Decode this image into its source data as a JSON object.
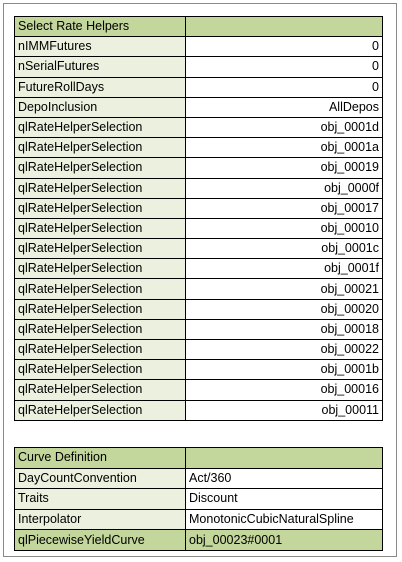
{
  "rate_helpers": {
    "header": "Select Rate Helpers",
    "params": [
      {
        "label": "nIMMFutures",
        "value": "0"
      },
      {
        "label": "nSerialFutures",
        "value": "0"
      },
      {
        "label": "FutureRollDays",
        "value": "0"
      },
      {
        "label": "DepoInclusion",
        "value": "AllDepos"
      }
    ],
    "selections": [
      {
        "label": "qlRateHelperSelection",
        "value": "obj_0001d"
      },
      {
        "label": "qlRateHelperSelection",
        "value": "obj_0001a"
      },
      {
        "label": "qlRateHelperSelection",
        "value": "obj_00019"
      },
      {
        "label": "qlRateHelperSelection",
        "value": "obj_0000f"
      },
      {
        "label": "qlRateHelperSelection",
        "value": "obj_00017"
      },
      {
        "label": "qlRateHelperSelection",
        "value": "obj_00010"
      },
      {
        "label": "qlRateHelperSelection",
        "value": "obj_0001c"
      },
      {
        "label": "qlRateHelperSelection",
        "value": "obj_0001f"
      },
      {
        "label": "qlRateHelperSelection",
        "value": "obj_00021"
      },
      {
        "label": "qlRateHelperSelection",
        "value": "obj_00020"
      },
      {
        "label": "qlRateHelperSelection",
        "value": "obj_00018"
      },
      {
        "label": "qlRateHelperSelection",
        "value": "obj_00022"
      },
      {
        "label": "qlRateHelperSelection",
        "value": "obj_0001b"
      },
      {
        "label": "qlRateHelperSelection",
        "value": "obj_00016"
      },
      {
        "label": "qlRateHelperSelection",
        "value": "obj_00011"
      }
    ]
  },
  "curve_definition": {
    "header": "Curve Definition",
    "rows": [
      {
        "label": "DayCountConvention",
        "value": "Act/360"
      },
      {
        "label": "Traits",
        "value": "Discount"
      },
      {
        "label": "Interpolator",
        "value": "MonotonicCubicNaturalSpline"
      }
    ],
    "result": {
      "label": "qlPiecewiseYieldCurve",
      "value": "obj_00023#0001"
    }
  },
  "colors": {
    "header_fill": "#c3d69b",
    "label_fill": "#ecf1df",
    "value_fill": "#ffffff",
    "border": "#000000"
  }
}
